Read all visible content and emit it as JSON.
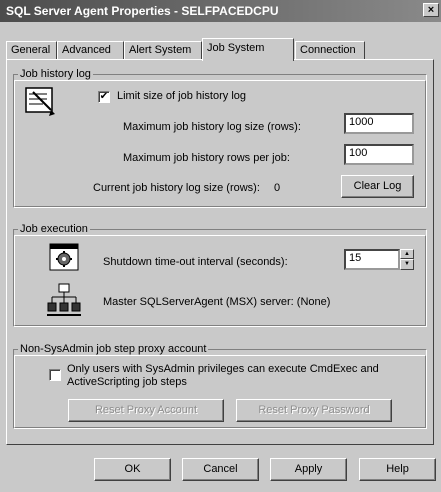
{
  "window": {
    "title": "SQL Server Agent Properties - SELFPACEDCPU",
    "close_glyph": "×"
  },
  "tabs": [
    {
      "label": "General",
      "active": false
    },
    {
      "label": "Advanced",
      "active": false
    },
    {
      "label": "Alert System",
      "active": false
    },
    {
      "label": "Job System",
      "active": true
    },
    {
      "label": "Connection",
      "active": false
    }
  ],
  "job_history": {
    "legend": "Job history log",
    "limit_label": "Limit size of job history log",
    "limit_checked": true,
    "max_size_label": "Maximum job history log size (rows):",
    "max_size_value": "1000",
    "max_per_job_label": "Maximum job history rows per job:",
    "max_per_job_value": "100",
    "current_size_label": "Current job history log size (rows):",
    "current_size_value": "0",
    "clear_log_label": "Clear Log"
  },
  "job_execution": {
    "legend": "Job execution",
    "shutdown_label": "Shutdown time-out interval (seconds):",
    "shutdown_value": "15",
    "msx_label": "Master SQLServerAgent (MSX) server: (None)"
  },
  "proxy": {
    "legend": "Non-SysAdmin job step proxy account",
    "only_sysadmin_label_line1": "Only users with SysAdmin privileges can execute CmdExec and",
    "only_sysadmin_label_line2": "ActiveScripting job steps",
    "only_sysadmin_checked": false,
    "reset_account_label": "Reset Proxy Account",
    "reset_password_label": "Reset Proxy Password"
  },
  "footer": {
    "ok_label": "OK",
    "cancel_label": "Cancel",
    "apply_label": "Apply",
    "help_label": "Help"
  }
}
